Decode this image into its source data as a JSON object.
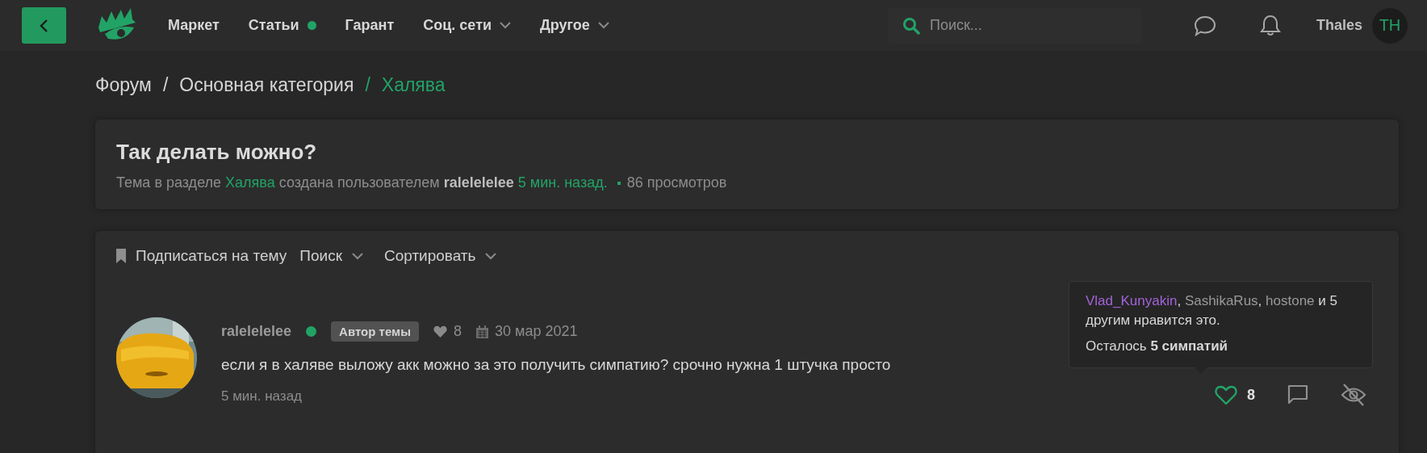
{
  "topbar": {
    "menu": [
      {
        "label": "Маркет",
        "dot": false,
        "dropdown": false
      },
      {
        "label": "Статьи",
        "dot": true,
        "dropdown": false
      },
      {
        "label": "Гарант",
        "dot": false,
        "dropdown": false
      },
      {
        "label": "Соц. сети",
        "dot": false,
        "dropdown": true
      },
      {
        "label": "Другое",
        "dot": false,
        "dropdown": true
      }
    ],
    "search": {
      "placeholder": "Поиск..."
    },
    "user": {
      "name": "Thales",
      "initials": "TH"
    }
  },
  "breadcrumbs": [
    {
      "label": "Форум",
      "selected": false
    },
    {
      "label": "Основная категория",
      "selected": false
    },
    {
      "label": "Халява",
      "selected": true
    }
  ],
  "breadcrumb_separator": "/",
  "thread": {
    "title": "Так делать можно?",
    "prefix": "Тема в разделе",
    "section": "Халява",
    "created_by": "создана пользователем",
    "author": "ralelelelee",
    "time": "5 мин. назад.",
    "views": "86 просмотров"
  },
  "toolbar": [
    {
      "label": "Подписаться на тему",
      "kind": "bookmark"
    },
    {
      "label": "Поиск",
      "kind": "dropdown"
    },
    {
      "label": "Сортировать",
      "kind": "dropdown"
    }
  ],
  "post": {
    "author": "ralelelelee",
    "online": true,
    "badge": "Автор темы",
    "likes": "8",
    "date": "30 мар 2021",
    "text": "если я в халяве выложу акк можно за это получить симпатию? срочно нужна 1 штучка просто",
    "time": "5 мин. назад",
    "liked": true,
    "like_count": "8"
  },
  "tooltip": {
    "users": [
      {
        "name": "Vlad_Kunyakin",
        "color": "#a363d9"
      },
      {
        "name": "SashikaRus",
        "color": "#9a9a9a"
      },
      {
        "name": "hostone",
        "color": "#9a9a9a"
      }
    ],
    "separator": ",",
    "rest": "и 5 другим нравится это.",
    "remaining": "Осталось **5 симпатий**"
  }
}
